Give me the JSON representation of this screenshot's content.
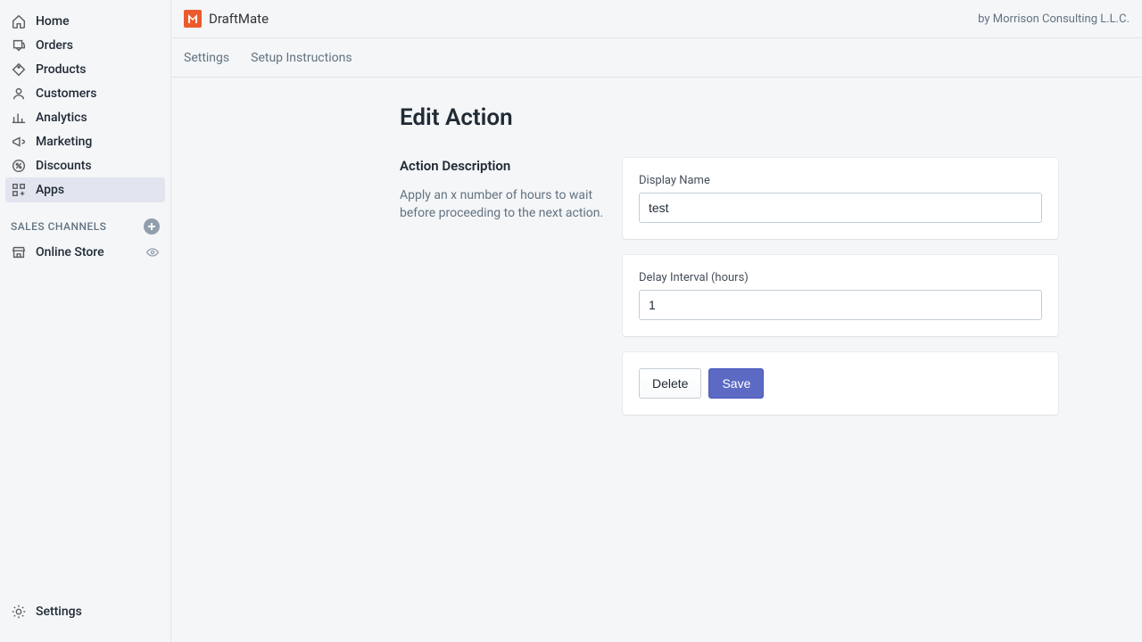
{
  "sidebar": {
    "items": [
      {
        "label": "Home"
      },
      {
        "label": "Orders"
      },
      {
        "label": "Products"
      },
      {
        "label": "Customers"
      },
      {
        "label": "Analytics"
      },
      {
        "label": "Marketing"
      },
      {
        "label": "Discounts"
      },
      {
        "label": "Apps"
      }
    ],
    "section_label": "SALES CHANNELS",
    "channel_label": "Online Store",
    "settings_label": "Settings"
  },
  "header": {
    "app_name": "DraftMate",
    "byline": "by Morrison Consulting L.L.C."
  },
  "tabs": {
    "settings": "Settings",
    "setup": "Setup Instructions"
  },
  "page": {
    "title": "Edit Action",
    "annot_title": "Action Description",
    "annot_text": "Apply an x number of hours to wait before proceeding to the next action.",
    "display_name_label": "Display Name",
    "display_name_value": "test",
    "delay_label": "Delay Interval (hours)",
    "delay_value": "1",
    "delete_label": "Delete",
    "save_label": "Save"
  }
}
